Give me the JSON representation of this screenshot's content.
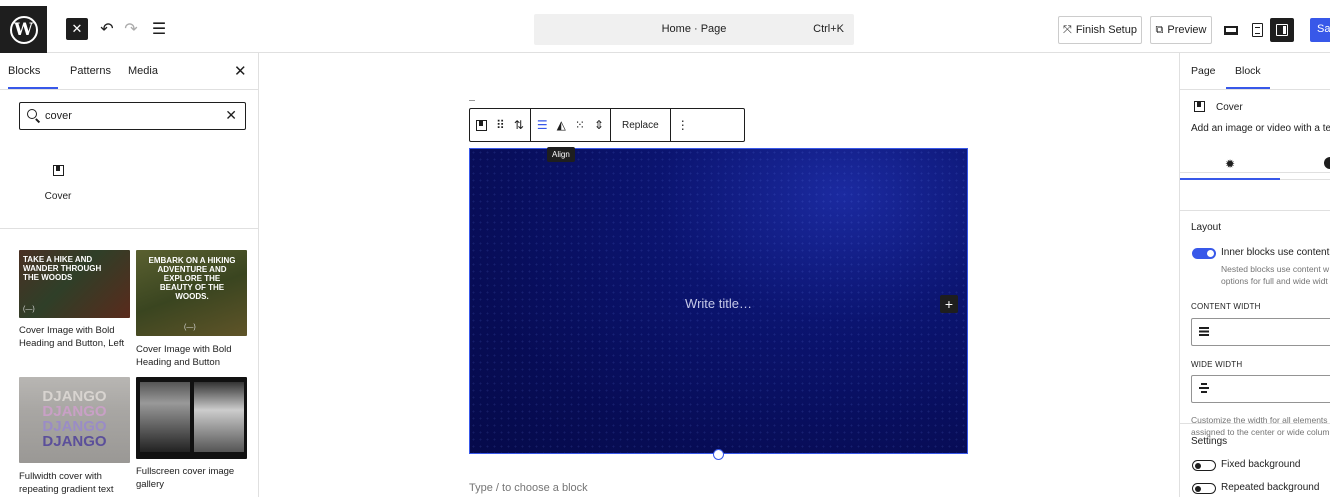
{
  "header": {
    "logo_letter": "W",
    "command_bar_title": "Home · Page",
    "command_bar_shortcut": "Ctrl+K",
    "finish_setup_label": "Finish Setup",
    "preview_label": "Preview",
    "save_label": "Save",
    "accent_color": "#3858e9"
  },
  "inserter": {
    "tabs": [
      "Blocks",
      "Patterns",
      "Media"
    ],
    "active_tab": "Blocks",
    "search": {
      "value": "cover"
    },
    "block_results": [
      {
        "label": "Cover",
        "icon": "cover-icon"
      }
    ],
    "patterns": [
      {
        "label": "Cover Image with Bold Heading and Button, Left",
        "thumb_text": "TAKE A HIKE AND WANDER THROUGH THE WOODS",
        "thumb_button": "(—)"
      },
      {
        "label": "Cover Image with Bold Heading and Button",
        "thumb_text": "EMBARK ON A HIKING ADVENTURE AND EXPLORE THE BEAUTY OF THE WOODS.",
        "thumb_button": "(—)"
      },
      {
        "label": "Fullwidth cover with repeating gradient text",
        "thumb_text": "DJANGO"
      },
      {
        "label": "Fullscreen cover image gallery"
      }
    ]
  },
  "canvas": {
    "toolbar": {
      "replace_label": "Replace",
      "tooltip": "Align"
    },
    "cover": {
      "title_placeholder": "Write title…",
      "add_symbol": "+"
    },
    "type_hint": "Type / to choose a block"
  },
  "sidebar": {
    "tabs": [
      "Page",
      "Block"
    ],
    "active_tab": "Block",
    "block_name": "Cover",
    "block_description": "Add an image or video with a text",
    "layout_heading": "Layout",
    "inner_blocks_label": "Inner blocks use content w",
    "inner_blocks_on": true,
    "inner_blocks_help": [
      "Nested blocks use content w",
      "options for full and wide widt"
    ],
    "content_width_label": "CONTENT WIDTH",
    "wide_width_label": "WIDE WIDTH",
    "customize_help": [
      "Customize the width for all elements",
      "assigned to the center or wide colum"
    ],
    "settings_heading": "Settings",
    "fixed_background_label": "Fixed background",
    "fixed_background_on": false,
    "repeated_background_label": "Repeated background",
    "repeated_background_on": false
  }
}
